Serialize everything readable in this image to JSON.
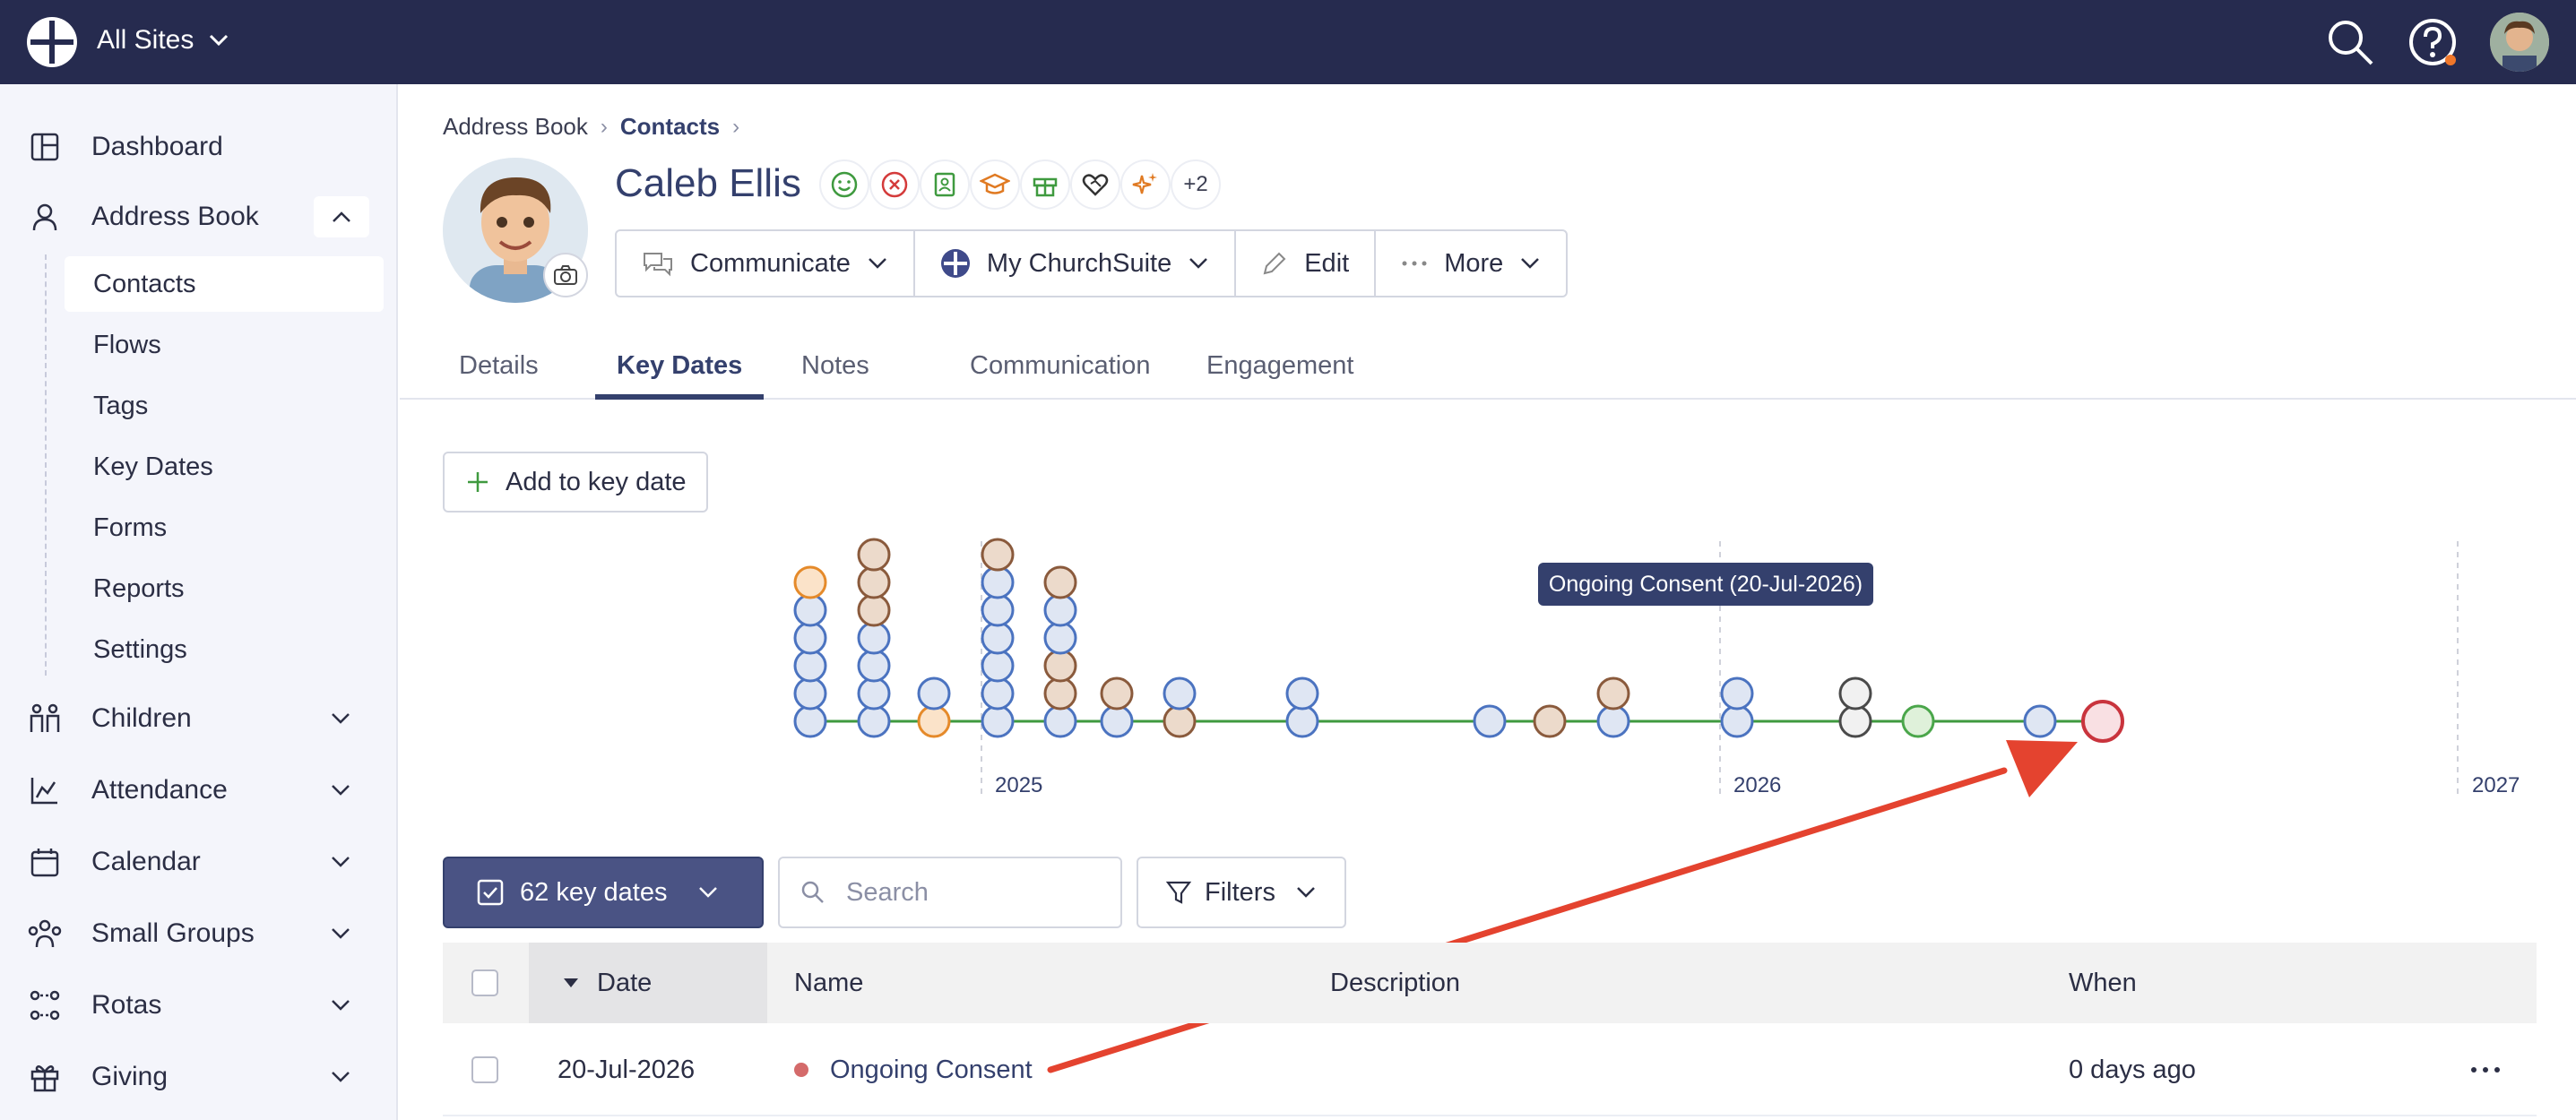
{
  "topbar": {
    "site_label": "All Sites"
  },
  "sidebar": {
    "items": [
      {
        "label": "Dashboard",
        "icon": "dashboard-icon"
      },
      {
        "label": "Address Book",
        "icon": "person-icon"
      },
      {
        "label": "Children",
        "icon": "children-icon"
      },
      {
        "label": "Attendance",
        "icon": "chart-icon"
      },
      {
        "label": "Calendar",
        "icon": "calendar-icon"
      },
      {
        "label": "Small Groups",
        "icon": "group-icon"
      },
      {
        "label": "Rotas",
        "icon": "rotas-icon"
      },
      {
        "label": "Giving",
        "icon": "gift-icon"
      }
    ],
    "sub_items": [
      "Contacts",
      "Flows",
      "Tags",
      "Key Dates",
      "Forms",
      "Reports",
      "Settings"
    ]
  },
  "breadcrumb": {
    "root": "Address Book",
    "current": "Contacts"
  },
  "profile": {
    "name": "Caleb Ellis",
    "badges_more": "+2",
    "actions": {
      "communicate": "Communicate",
      "churchsuite": "My ChurchSuite",
      "edit": "Edit",
      "more": "More"
    }
  },
  "tabs": [
    "Details",
    "Key Dates",
    "Notes",
    "Communication",
    "Engagement"
  ],
  "add_button": "Add to key date",
  "timeline": {
    "years": [
      "2025",
      "2026",
      "2027"
    ],
    "tooltip": "Ongoing Consent (20-Jul-2026)"
  },
  "toolbar": {
    "count_label": "62 key dates",
    "search_placeholder": "Search",
    "filters_label": "Filters"
  },
  "table": {
    "headers": {
      "date": "Date",
      "name": "Name",
      "description": "Description",
      "when": "When"
    },
    "rows": [
      {
        "date": "20-Jul-2026",
        "name": "Ongoing Consent",
        "description": "",
        "when": "0 days ago"
      }
    ]
  },
  "colors": {
    "navy": "#262b4f",
    "accent": "#34406d",
    "arrow": "#e4432f",
    "line": "#3f9a3f"
  }
}
